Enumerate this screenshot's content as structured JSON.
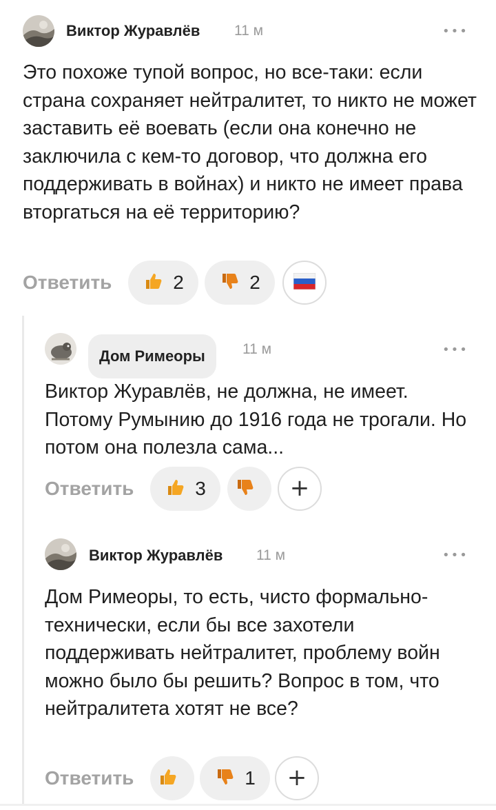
{
  "comments": [
    {
      "author": "Виктор Журавлёв",
      "time": "11 м",
      "more": "•••",
      "text": "Это похоже тупой вопрос, но все-таки: если страна сохраняет нейтралитет, то никто не может заставить её воевать (если она конечно не заключила с кем-то договор, что должна его поддерживать в войнах) и никто не имеет права вторгаться на её территорию?",
      "reply_label": "Ответить",
      "likes": "2",
      "dislikes": "2",
      "reaction": "russian-flag"
    },
    {
      "author": "Дом Римеоры",
      "time": "11 м",
      "more": "•••",
      "text": "Виктор Журавлёв, не должна, не имеет. Потому Румынию до 1916 года не трогали. Но потом она полезла сама...",
      "reply_label": "Ответить",
      "likes": "3",
      "dislikes": "",
      "add_reaction": "+"
    },
    {
      "author": "Виктор Журавлёв",
      "time": "11 м",
      "more": "•••",
      "text": "Дом Римеоры, то есть, чисто формально-технически, если бы все захотели поддерживать нейтралитет, проблему войн можно было бы решить? Вопрос в том, что нейтралитета хотят не все?",
      "reply_label": "Ответить",
      "likes": "",
      "dislikes": "1",
      "add_reaction": "+"
    }
  ],
  "colors": {
    "pill_bg": "#efefef",
    "muted": "#a3a3a3",
    "thumb_up": "#f5a623",
    "thumb_down": "#e8821a"
  }
}
